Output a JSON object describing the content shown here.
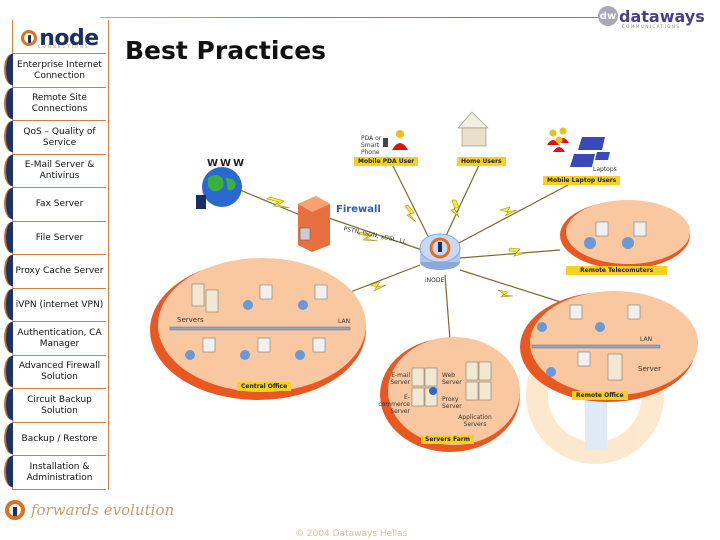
{
  "header": {
    "title": "Best Practices",
    "brand_logo": "node",
    "brand_logo_sub": "CONNECTIONS",
    "partner_logo": "dataways",
    "partner_logo_mark": "dw",
    "partner_logo_sub": "COMMUNICATIONS"
  },
  "sidebar": {
    "items": [
      {
        "label": "Enterprise Internet Connection"
      },
      {
        "label": "Remote Site Connections"
      },
      {
        "label": "QoS – Quality of Service"
      },
      {
        "label": "E-Mail Server & Antivirus"
      },
      {
        "label": "Fax Server"
      },
      {
        "label": "File Server"
      },
      {
        "label": "Proxy Cache Server"
      },
      {
        "label": "iVPN (internet VPN)"
      },
      {
        "label": "Authentication, CA Manager"
      },
      {
        "label": "Advanced Firewall Solution"
      },
      {
        "label": "Circuit Backup Solution"
      },
      {
        "label": "Backup / Restore"
      },
      {
        "label": "Installation & Administration"
      }
    ]
  },
  "diagram": {
    "www": "WWW",
    "firewall": "Firewall",
    "link_types": "PSTN, ISDN, xDSL, LL",
    "hub": "iNODE",
    "pda_note": "PDA or Smart Phone",
    "mobile_pda": "Mobile PDA User",
    "home_users": "Home Users",
    "laptop_note": "Laptops",
    "mobile_laptop": "Mobile Laptop Users",
    "remote_telecommuters": "Remote Telecomuters",
    "central_office": "Central Office",
    "servers": "Servers",
    "lan": "LAN",
    "servers_farm": "Servers Farm",
    "email_server": "E-mail Server",
    "web_server": "Web Server",
    "ecommerce_server": "E-commerce Server",
    "proxy_server": "Proxy Server",
    "application_servers": "Application Servers",
    "remote_office": "Remote Office",
    "server": "Server"
  },
  "footer": {
    "tagline": "forwards evolution",
    "copyright": "© 2004 Dataways Hellas"
  },
  "colors": {
    "accent_orange": "#e07020",
    "navy": "#1a3566",
    "label_yellow": "#f8d020",
    "cloud_peach": "#f9c8a0",
    "firewall_blue": "#2a5cc0"
  }
}
